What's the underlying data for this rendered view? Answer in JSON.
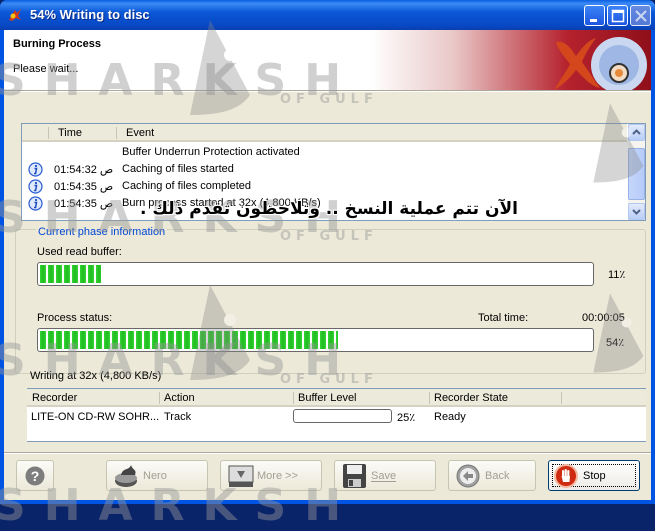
{
  "window": {
    "title": "54% Writing to disc",
    "controls": [
      "minimize",
      "maximize",
      "close"
    ]
  },
  "header": {
    "title": "Burning Process",
    "subtitle": "Please wait..."
  },
  "watermark": {
    "text": "SHARKSH",
    "sub": "OF GULF"
  },
  "log": {
    "columns": [
      "Time",
      "Event"
    ],
    "rows": [
      {
        "icon": "none",
        "time": "",
        "event": "Buffer Underrun Protection activated"
      },
      {
        "icon": "info-icon",
        "time": "01:54:32 ص",
        "event": "Caching of files started"
      },
      {
        "icon": "info-icon",
        "time": "01:54:35 ص",
        "event": "Caching of files completed"
      },
      {
        "icon": "info-icon",
        "time": "01:54:35 ص",
        "event": "Burn process started at 32x (4,800 KB/s)"
      }
    ]
  },
  "phase": {
    "group_label": "Current phase information",
    "overlay_arabic": "الآن تتم عملية النسخ .. وتلاحظون تقدم ذلك .",
    "used_buffer_label": "Used read buffer:",
    "used_buffer_percent": 11,
    "used_buffer_text": "11٪",
    "process_label": "Process status:",
    "total_time_label": "Total time:",
    "total_time": "00:00:05",
    "process_percent": 54,
    "process_text": "54٪"
  },
  "status_text": "Writing at 32x (4,800 KB/s)",
  "recorders": {
    "columns": [
      "Recorder",
      "Action",
      "Buffer Level",
      "Recorder State"
    ],
    "rows": [
      {
        "recorder": "LITE-ON CD-RW SOHR...",
        "action": "Track",
        "buffer_percent": 25,
        "buffer_text": "25٪",
        "state": "Ready"
      }
    ]
  },
  "buttons": {
    "help": "?",
    "nero": "Nero",
    "more": "More >>",
    "save": "Save",
    "back": "Back",
    "stop": "Stop"
  },
  "colors": {
    "progress_green": "#2bc82b",
    "phase_label_blue": "#0046d5",
    "titlebar_blue": "#0054e3"
  }
}
